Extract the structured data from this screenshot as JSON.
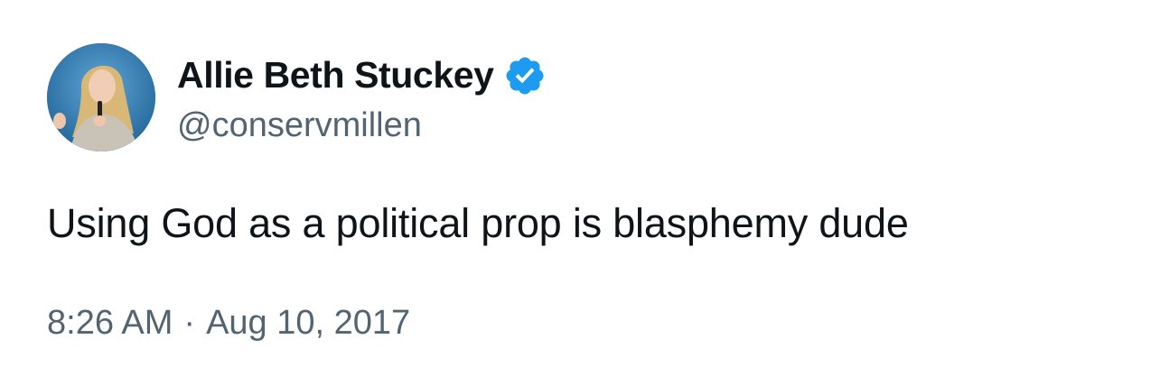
{
  "author": {
    "display_name": "Allie Beth Stuckey",
    "handle": "@conservmillen",
    "verified": true,
    "avatar": "profile-photo"
  },
  "tweet": {
    "text": "Using God as a political prop is blasphemy dude",
    "time": "8:26 AM",
    "separator": "·",
    "date": "Aug 10, 2017"
  },
  "colors": {
    "text_primary": "#0f1419",
    "text_secondary": "#536471",
    "verified_blue": "#1d9bf0",
    "background": "#ffffff"
  },
  "icons": {
    "verified": "verified-badge-icon"
  }
}
